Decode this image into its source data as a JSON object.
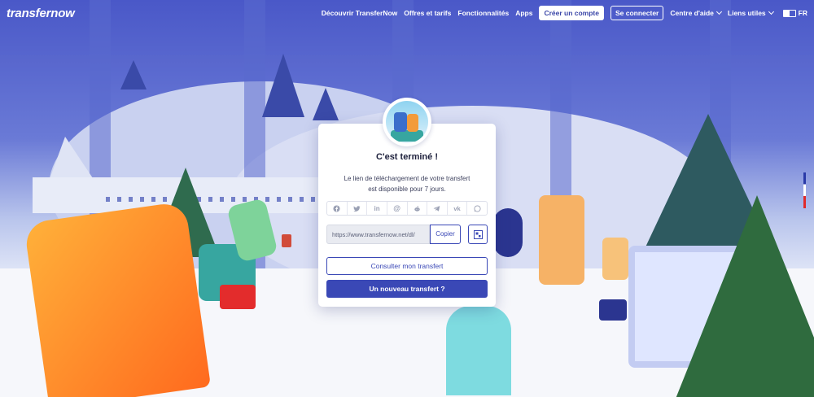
{
  "header": {
    "logo": "transfernow",
    "nav": {
      "discover": "Découvrir TransferNow",
      "pricing": "Offres et tarifs",
      "features": "Fonctionnalités",
      "apps": "Apps",
      "create_account": "Créer un compte",
      "login": "Se connecter",
      "help_center": "Centre d'aide",
      "useful_links": "Liens utiles",
      "language": "FR"
    }
  },
  "modal": {
    "title": "C'est terminé !",
    "description_line1": "Le lien de téléchargement de votre transfert",
    "description_line2": "est disponible pour 7 jours.",
    "share_icons": [
      "facebook-icon",
      "twitter-icon",
      "linkedin-icon",
      "email-icon",
      "reddit-icon",
      "telegram-icon",
      "vk-icon",
      "whatsapp-icon"
    ],
    "link_value": "https://www.transfernow.net/dl/",
    "copy_label": "Copier",
    "view_transfer_label": "Consulter mon transfert",
    "new_transfer_label": "Un nouveau transfert ?"
  },
  "colors": {
    "accent": "#3a48b6",
    "background_top": "#4a58c8"
  }
}
